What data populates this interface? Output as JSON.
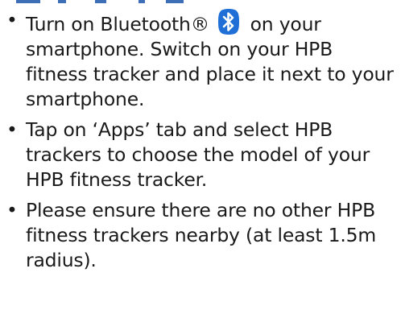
{
  "colors": {
    "text": "#1a1a1a",
    "bluetooth_icon_bg": "#1f6fd6",
    "bluetooth_icon_fg": "#ffffff"
  },
  "bullet_symbol": "•",
  "steps": [
    {
      "before_icon": "Turn on Bluetooth®",
      "icon": "bluetooth-icon",
      "after_icon": "on your smartphone. Switch on your HPB fitness tracker and place it next to your smartphone."
    },
    {
      "text": "Tap on ‘Apps’ tab and select HPB trackers to choose the model of your HPB fitness tracker."
    },
    {
      "text": "Please ensure there are no other HPB fitness trackers nearby (at least 1.5m radius)."
    }
  ]
}
